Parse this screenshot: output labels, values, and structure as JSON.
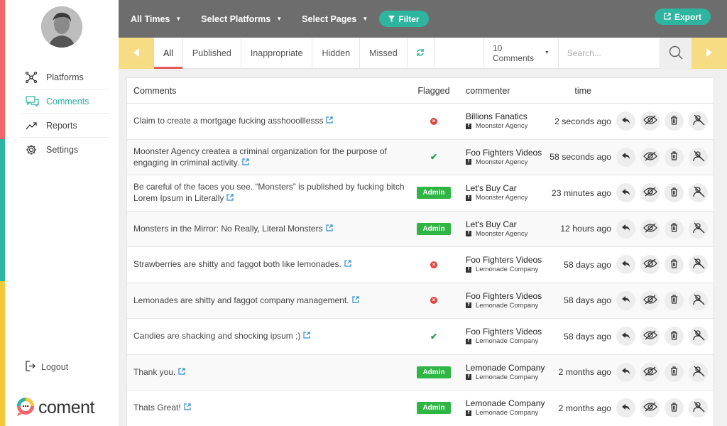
{
  "colors": {
    "accent": "#2eb5a0",
    "tab_indicator": "#e35a5a",
    "arrow_bg": "#f6dc82",
    "topbar": "#6d6d6d",
    "stripe_top": "#f0666a",
    "stripe_mid": "#2eb5a0",
    "stripe_bottom": "#f3c93c"
  },
  "sidebar": {
    "items": [
      {
        "label": "Platforms",
        "icon": "network-icon"
      },
      {
        "label": "Comments",
        "icon": "chat-bubbles-icon",
        "active": true
      },
      {
        "label": "Reports",
        "icon": "trend-line-icon"
      },
      {
        "label": "Settings",
        "icon": "gear-icon"
      }
    ],
    "logout": "Logout",
    "brand": "coment"
  },
  "topbar": {
    "all_times": "All Times",
    "select_platforms": "Select Platforms",
    "select_pages": "Select Pages",
    "filter": "Filter",
    "export": "Export"
  },
  "tabs": [
    "All",
    "Published",
    "Inappropriate",
    "Hidden",
    "Missed"
  ],
  "count_select": "10 Comments",
  "search_placeholder": "Search...",
  "columns": {
    "comments": "Comments",
    "flagged": "Flagged",
    "commenter": "commenter",
    "time": "time"
  },
  "rows": [
    {
      "comment": "Claim to create a mortgage fucking asshooolllesss",
      "flag": "x",
      "name": "Billions Fanatics",
      "page": "Moonster Agency",
      "time": "2 seconds ago"
    },
    {
      "comment": "Moonster Agency createa a criminal organization for the purpose of engaging in criminal activity.",
      "flag": "ok",
      "name": "Foo Fighters Videos",
      "page": "Moonster Agency",
      "time": "58 seconds ago"
    },
    {
      "comment": "Be careful of the faces you see. “Monsters” is published by fucking bitch Lorem Ipsum in Literally",
      "flag": "admin",
      "name": "Let's Buy Car",
      "page": "Moonster Agency",
      "time": "23 minutes ago"
    },
    {
      "comment": "Monsters in the Mirror: No Really, Literal Monsters",
      "flag": "admin",
      "name": "Let's Buy Car",
      "page": "Moonster Agency",
      "time": "12 hours ago"
    },
    {
      "comment": "Strawberries are shitty and faggot both like lemonades.",
      "flag": "x",
      "name": "Foo Fighters Videos",
      "page": "Lemonade Company",
      "time": "58 days ago"
    },
    {
      "comment": "Lemonades are shitty and faggot company management.",
      "flag": "x",
      "name": "Foo Fighters Videos",
      "page": "Lemonade Company",
      "time": "58 days ago"
    },
    {
      "comment": "Candies are shacking and shocking ipsum ;)",
      "flag": "ok",
      "name": "Foo Fighters Videos",
      "page": "Lemonade Company",
      "time": "58 days ago"
    },
    {
      "comment": "Thank you.",
      "flag": "admin",
      "name": "Lemonade Company",
      "page": "Lemonade Company",
      "time": "2 months ago"
    },
    {
      "comment": "Thats Great!",
      "flag": "admin",
      "name": "Lemonade Company",
      "page": "Lemonade Company",
      "time": "2 months ago"
    }
  ],
  "admin_label": "Admin"
}
